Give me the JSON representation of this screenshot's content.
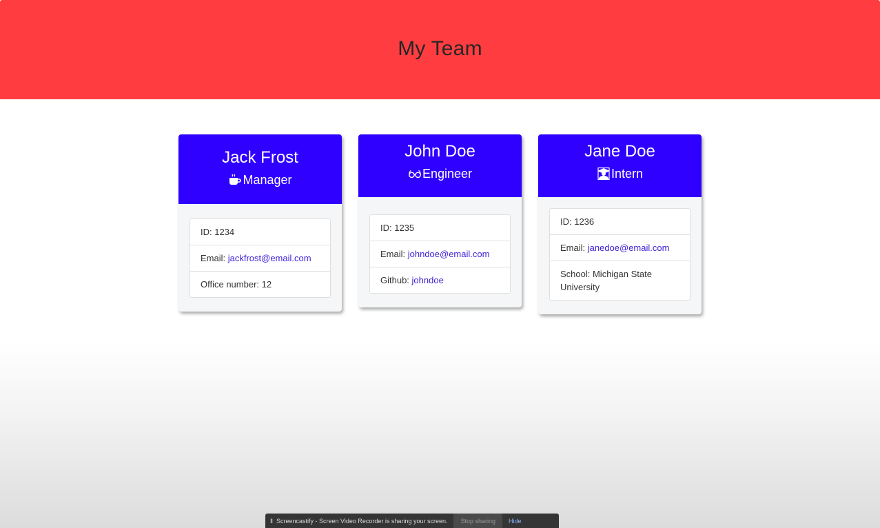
{
  "header": {
    "title": "My Team"
  },
  "colors": {
    "header_bg": "#ff3d41",
    "card_head_bg": "#2f00ff",
    "link": "#3c1fd6"
  },
  "team": [
    {
      "name": "Jack Frost",
      "role": "Manager",
      "role_icon": "mug-icon",
      "id_label": "ID: 1234",
      "email_prefix": "Email: ",
      "email": "jackfrost@email.com",
      "extra_prefix": "Office number: 12",
      "extra_link": ""
    },
    {
      "name": "John Doe",
      "role": "Engineer",
      "role_icon": "glasses-icon",
      "id_label": "ID: 1235",
      "email_prefix": "Email: ",
      "email": "johndoe@email.com",
      "extra_prefix": "Github: ",
      "extra_link": "johndoe"
    },
    {
      "name": "Jane Doe",
      "role": "Intern",
      "role_icon": "graduate-icon",
      "id_label": "ID: 1236",
      "email_prefix": "Email: ",
      "email": "janedoe@email.com",
      "extra_prefix": "School: Michigan State University",
      "extra_link": ""
    }
  ],
  "share_bar": {
    "pause_glyph": "II",
    "message": "Screencastify - Screen Video Recorder is sharing your screen.",
    "stop_label": "Stop sharing",
    "hide_label": "Hide"
  }
}
